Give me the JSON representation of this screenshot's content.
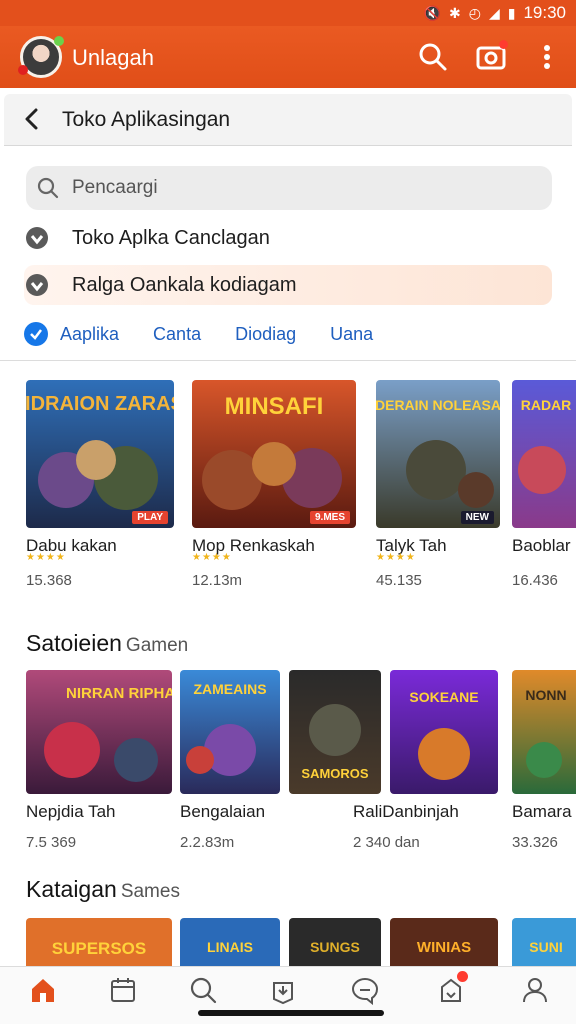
{
  "status_bar": {
    "time": "19:30",
    "icons": [
      "mute-icon",
      "bluetooth-icon",
      "wifi-icon",
      "signal-icon",
      "battery-icon"
    ]
  },
  "app_bar": {
    "title": "Unlagah",
    "actions": [
      "search-icon",
      "camera-icon",
      "more-icon"
    ]
  },
  "sheet": {
    "title": "Toko Aplikasingan"
  },
  "search": {
    "placeholder": "Pencaargi"
  },
  "suggestions": [
    {
      "label": "Toko Aplka Canclagan",
      "icon": "shield-icon"
    },
    {
      "label": "Ralga Oankala kodiagam",
      "icon": "shield-icon"
    }
  ],
  "chips": [
    "Aaplika",
    "Canta",
    "Diodiag",
    "Uana"
  ],
  "row1": {
    "items": [
      {
        "name": "Dabu kakan",
        "count": "15.368",
        "art": "RIDRAION ZARASI",
        "tag": "PLAY",
        "rating": 4
      },
      {
        "name": "Mop Renkaskah",
        "count": "12.13m",
        "art": "MINSAFI",
        "tag": "9.MES",
        "rating": 4
      },
      {
        "name": "Talyk Tah",
        "count": "45.135",
        "art": "NDERAIN NOLEASAN",
        "tag": "NEW",
        "rating": 4
      },
      {
        "name": "Baoblar",
        "count": "16.436",
        "art": "RADAR",
        "tag": "",
        "rating": 0
      }
    ]
  },
  "section2": {
    "title": "Satoieien",
    "subtitle": "Gamen"
  },
  "row2": {
    "items": [
      {
        "name": "Nepjdia Tah",
        "count": "7.5 369",
        "art": "NIRRAN RIPHAN",
        "tag": "",
        "rating": 0
      },
      {
        "name": "Bengalaian",
        "count": "2.2.83m",
        "art": "ZAMEAINS",
        "tag": "",
        "rating": 0
      },
      {
        "name": "RaliDanbinjah",
        "count": "2 340 dan",
        "art": "SAMOROS",
        "tag": "",
        "rating": 0
      },
      {
        "name": "",
        "count": "",
        "art": "SOKEANE",
        "tag": "",
        "rating": 0
      },
      {
        "name": "Bamara",
        "count": "33.326",
        "art": "NONN",
        "tag": "",
        "rating": 0
      }
    ]
  },
  "section3": {
    "title": "Kataigan",
    "subtitle": "Sames"
  },
  "row3": {
    "items": [
      {
        "art": "SUPERSOS"
      },
      {
        "art": "LINAIS"
      },
      {
        "art": "SUNGS"
      },
      {
        "art": "WINIAS"
      },
      {
        "art": "SUNI"
      }
    ]
  },
  "bottom_nav": {
    "items": [
      "home-icon",
      "calendar-icon",
      "search-icon",
      "download-icon",
      "chat-icon",
      "notifications-icon",
      "profile-icon"
    ],
    "active": "home-icon",
    "accent": "#e3501c"
  }
}
